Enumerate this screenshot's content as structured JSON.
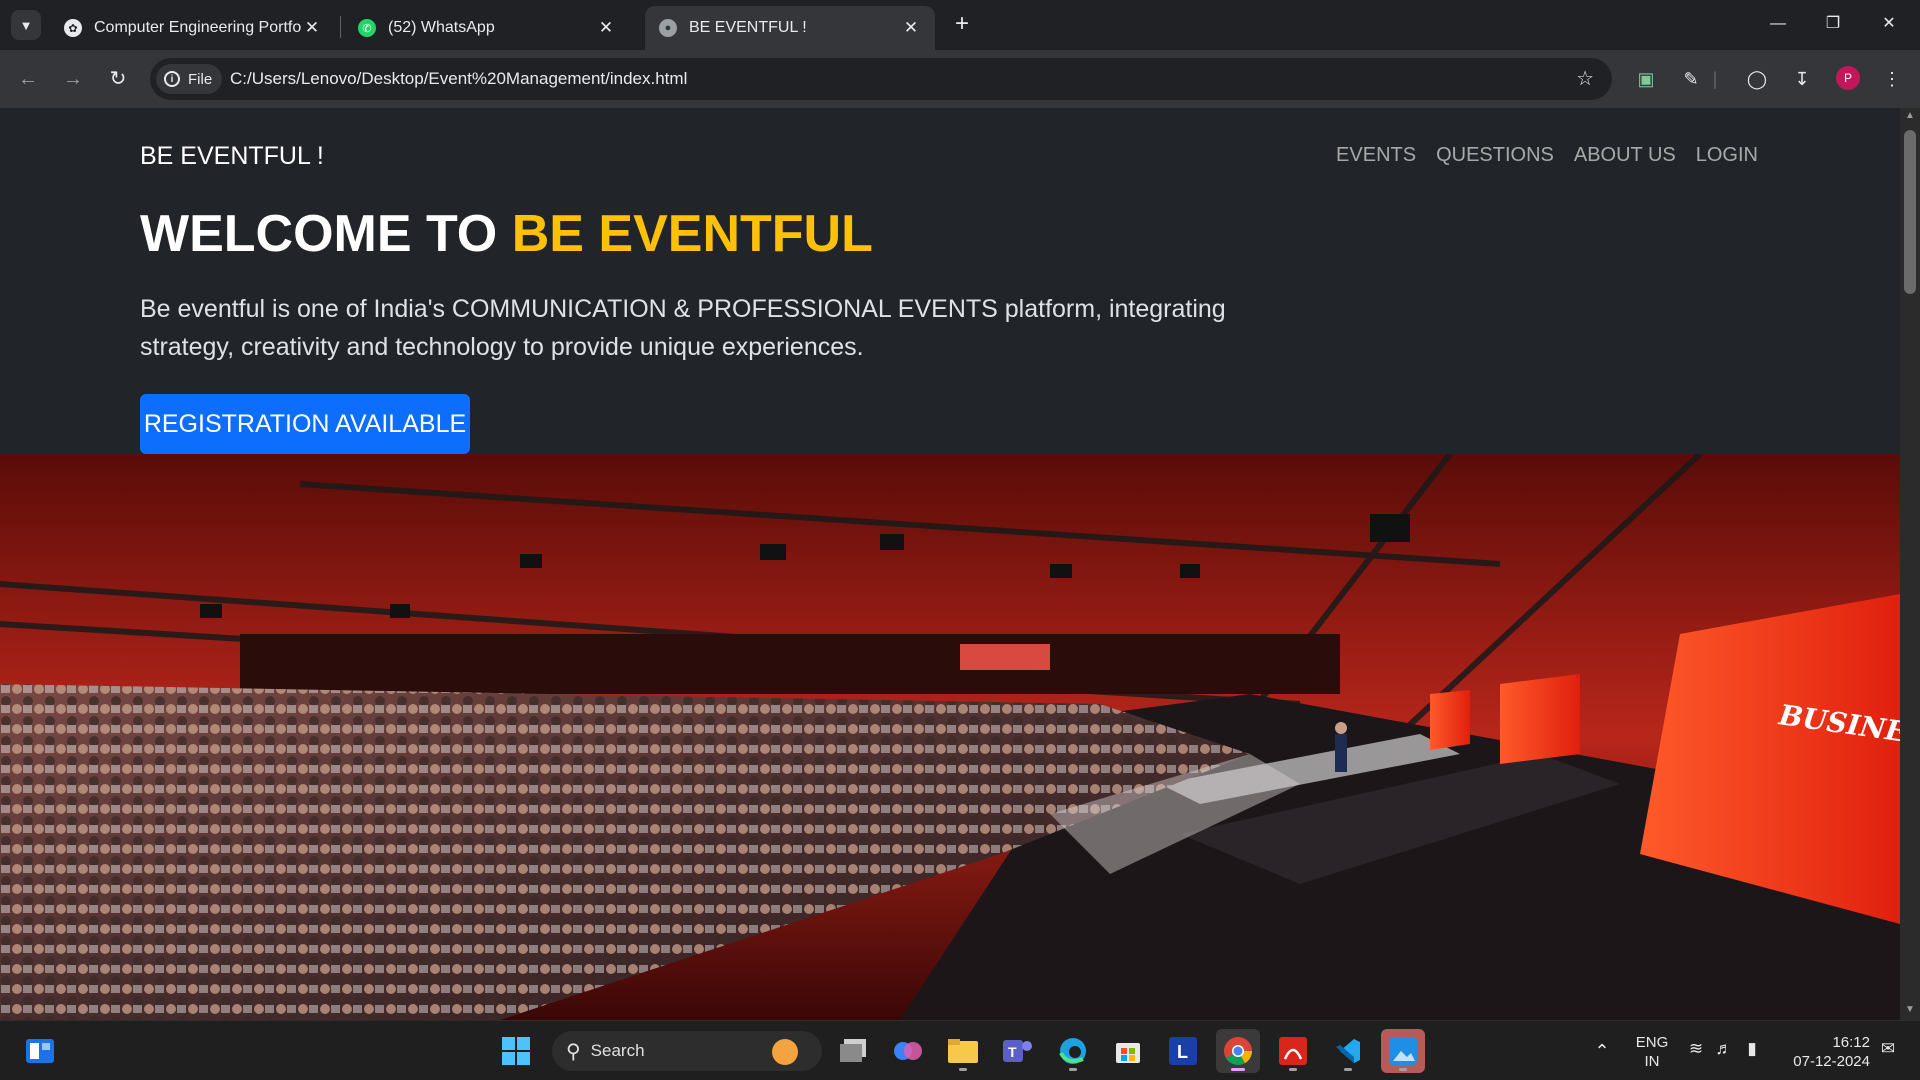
{
  "browser": {
    "tabs": [
      {
        "title": "Computer Engineering Portfolio",
        "icon": "chatgpt-icon",
        "active": false
      },
      {
        "title": "(52) WhatsApp",
        "icon": "whatsapp-icon",
        "active": false
      },
      {
        "title": "BE EVENTFUL !",
        "icon": "globe-icon",
        "active": true
      }
    ],
    "site_chip_label": "File",
    "url": "C:/Users/Lenovo/Desktop/Event%20Management/index.html",
    "profile_initial": "P"
  },
  "page": {
    "brand": "BE EVENTFUL !",
    "nav": [
      "EVENTS",
      "QUESTIONS",
      "ABOUT US",
      "LOGIN"
    ],
    "hero_title_prefix": "WELCOME TO",
    "hero_title_highlight": "BE EVENTFUL",
    "lead": "Be eventful is one of India's COMMUNICATION & PROFESSIONAL EVENTS platform, integrating strategy, creativity and technology to provide unique experiences.",
    "cta": "REGISTRATION AVAILABLE",
    "hero_image_text": "BUSINES COMP",
    "colors": {
      "highlight": "#ffc107",
      "primary": "#0d6efd",
      "background": "#212529"
    }
  },
  "taskbar": {
    "search_label": "Search",
    "language_top": "ENG",
    "language_bottom": "IN",
    "time": "16:12",
    "date": "07-12-2024"
  }
}
